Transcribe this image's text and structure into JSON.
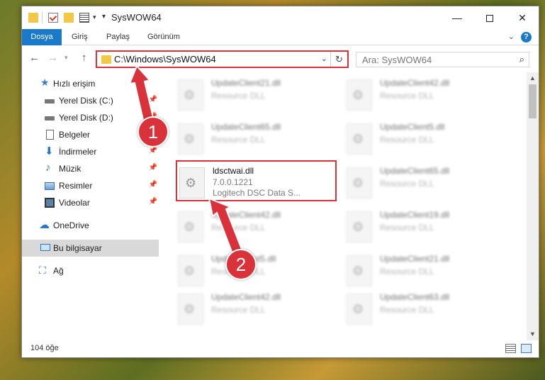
{
  "window": {
    "title": "SysWOW64"
  },
  "ribbon": {
    "tabs": [
      "Dosya",
      "Giriş",
      "Paylaş",
      "Görünüm"
    ],
    "help": "?"
  },
  "address": {
    "path": "C:\\Windows\\SysWOW64"
  },
  "search": {
    "placeholder": "Ara: SysWOW64"
  },
  "sidebar": {
    "items": [
      {
        "label": "Hızlı erişim",
        "icon": "star-icon"
      },
      {
        "label": "Yerel Disk (C:)",
        "icon": "drive-icon",
        "pinned": true
      },
      {
        "label": "Yerel Disk (D:)",
        "icon": "drive-icon",
        "pinned": true
      },
      {
        "label": "Belgeler",
        "icon": "document-icon",
        "pinned": true
      },
      {
        "label": "İndirmeler",
        "icon": "download-icon",
        "pinned": true
      },
      {
        "label": "Müzik",
        "icon": "music-icon",
        "pinned": true
      },
      {
        "label": "Resimler",
        "icon": "pictures-icon",
        "pinned": true
      },
      {
        "label": "Videolar",
        "icon": "video-icon",
        "pinned": true
      },
      {
        "label": "OneDrive",
        "icon": "cloud-icon"
      },
      {
        "label": "Bu bilgisayar",
        "icon": "computer-icon",
        "selected": true
      },
      {
        "label": "Ağ",
        "icon": "network-icon"
      }
    ]
  },
  "files": [
    {
      "name": "UpdateClient21.dll",
      "desc": "Resource DLL"
    },
    {
      "name": "UpdateClient42.dll",
      "desc": "Resource DLL"
    },
    {
      "name": "UpdateClient65.dll",
      "desc": "Resource DLL"
    },
    {
      "name": "UpdateClient5.dll",
      "desc": "Resource DLL"
    },
    {
      "name": "ldsctwai.dll",
      "version": "7.0.0.1221",
      "desc": "Logitech DSC Data S...",
      "highlighted": true
    },
    {
      "name": "UpdateClient65.dll",
      "desc": "Resource DLL"
    },
    {
      "name": "UpdateClient42.dll",
      "desc": "Resource DLL"
    },
    {
      "name": "UpdateClient19.dll",
      "desc": "Resource DLL"
    },
    {
      "name": "UpdateClient5.dll",
      "desc": "Resource DLL"
    },
    {
      "name": "UpdateClient21.dll",
      "desc": "Resource DLL"
    },
    {
      "name": "UpdateClient42.dll",
      "desc": "Resource DLL"
    },
    {
      "name": "UpdateClient63.dll",
      "desc": "Resource DLL"
    }
  ],
  "status": {
    "count": "104 öğe"
  },
  "annotations": {
    "badge1": "1",
    "badge2": "2",
    "color": "#d9323a"
  }
}
